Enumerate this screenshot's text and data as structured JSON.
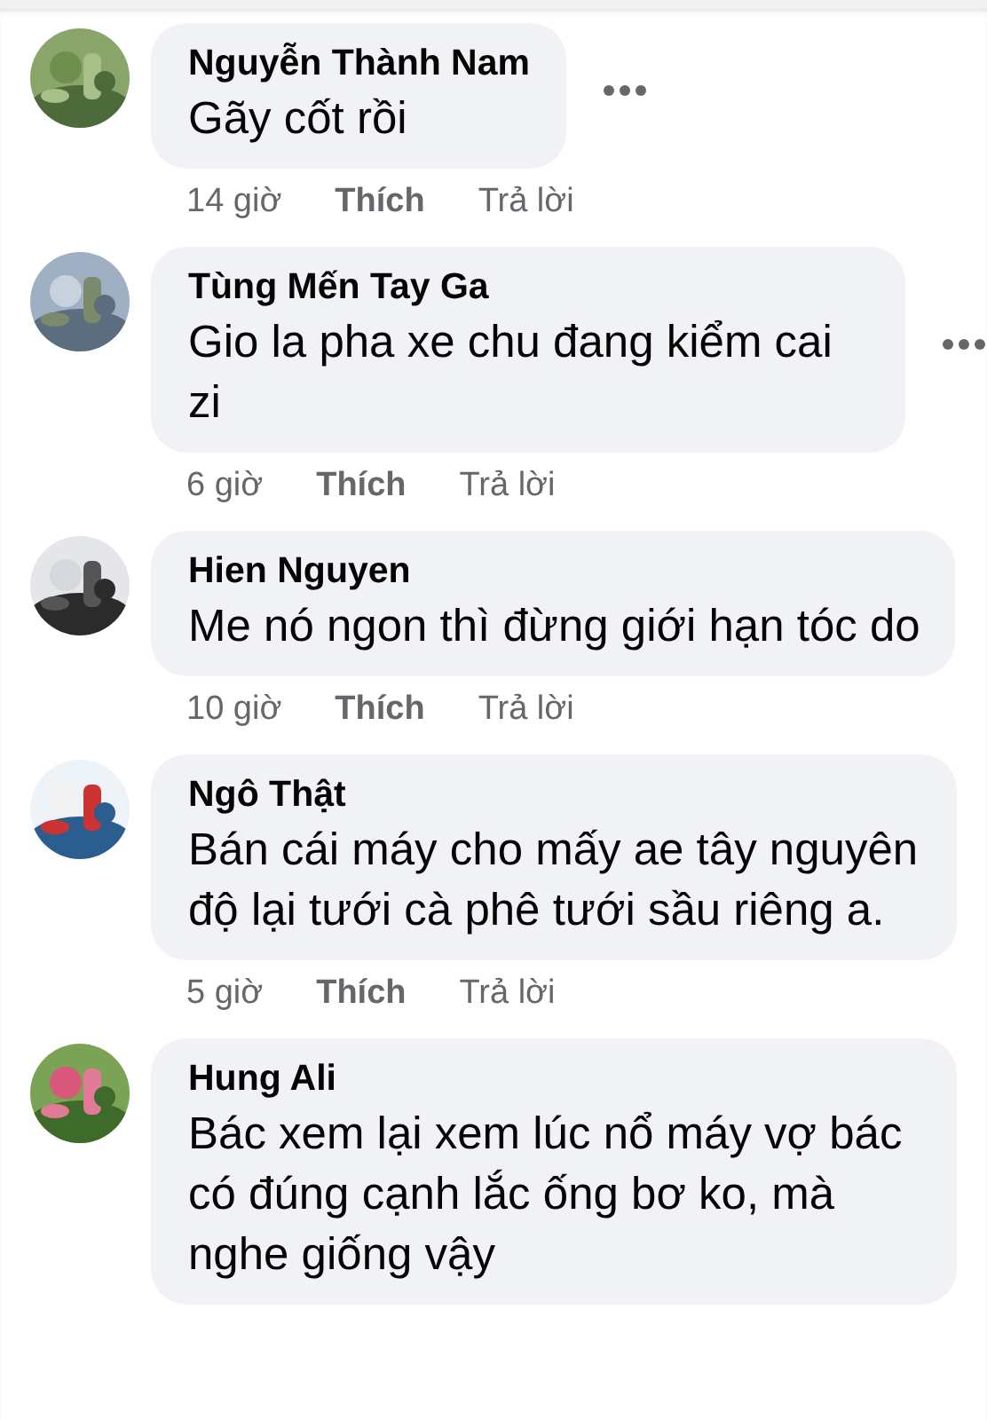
{
  "comments": [
    {
      "author": "Nguyễn Thành Nam",
      "text": "Gãy cốt rồi",
      "time": "14 giờ",
      "like": "Thích",
      "reply": "Trả lời",
      "menu_shown": true
    },
    {
      "author": "Tùng Mến Tay Ga",
      "text": "Gio la pha xe chu đang kiểm cai zi",
      "time": "6 giờ",
      "like": "Thích",
      "reply": "Trả lời",
      "menu_shown": true
    },
    {
      "author": "Hien Nguyen",
      "text": "Me nó ngon thì đừng giới hạn tóc do",
      "time": "10 giờ",
      "like": "Thích",
      "reply": "Trả lời",
      "menu_shown": false
    },
    {
      "author": "Ngô Thật",
      "text": "Bán cái máy cho mấy ae tây nguyên độ lại tưới cà phê tưới sầu riêng a.",
      "time": "5 giờ",
      "like": "Thích",
      "reply": "Trả lời",
      "menu_shown": false
    },
    {
      "author": "Hung Ali",
      "text": "Bác xem lại xem lúc nổ máy vợ bác có đúng cạnh lắc ống bơ ko, mà nghe giống vậy",
      "menu_shown": false
    }
  ]
}
